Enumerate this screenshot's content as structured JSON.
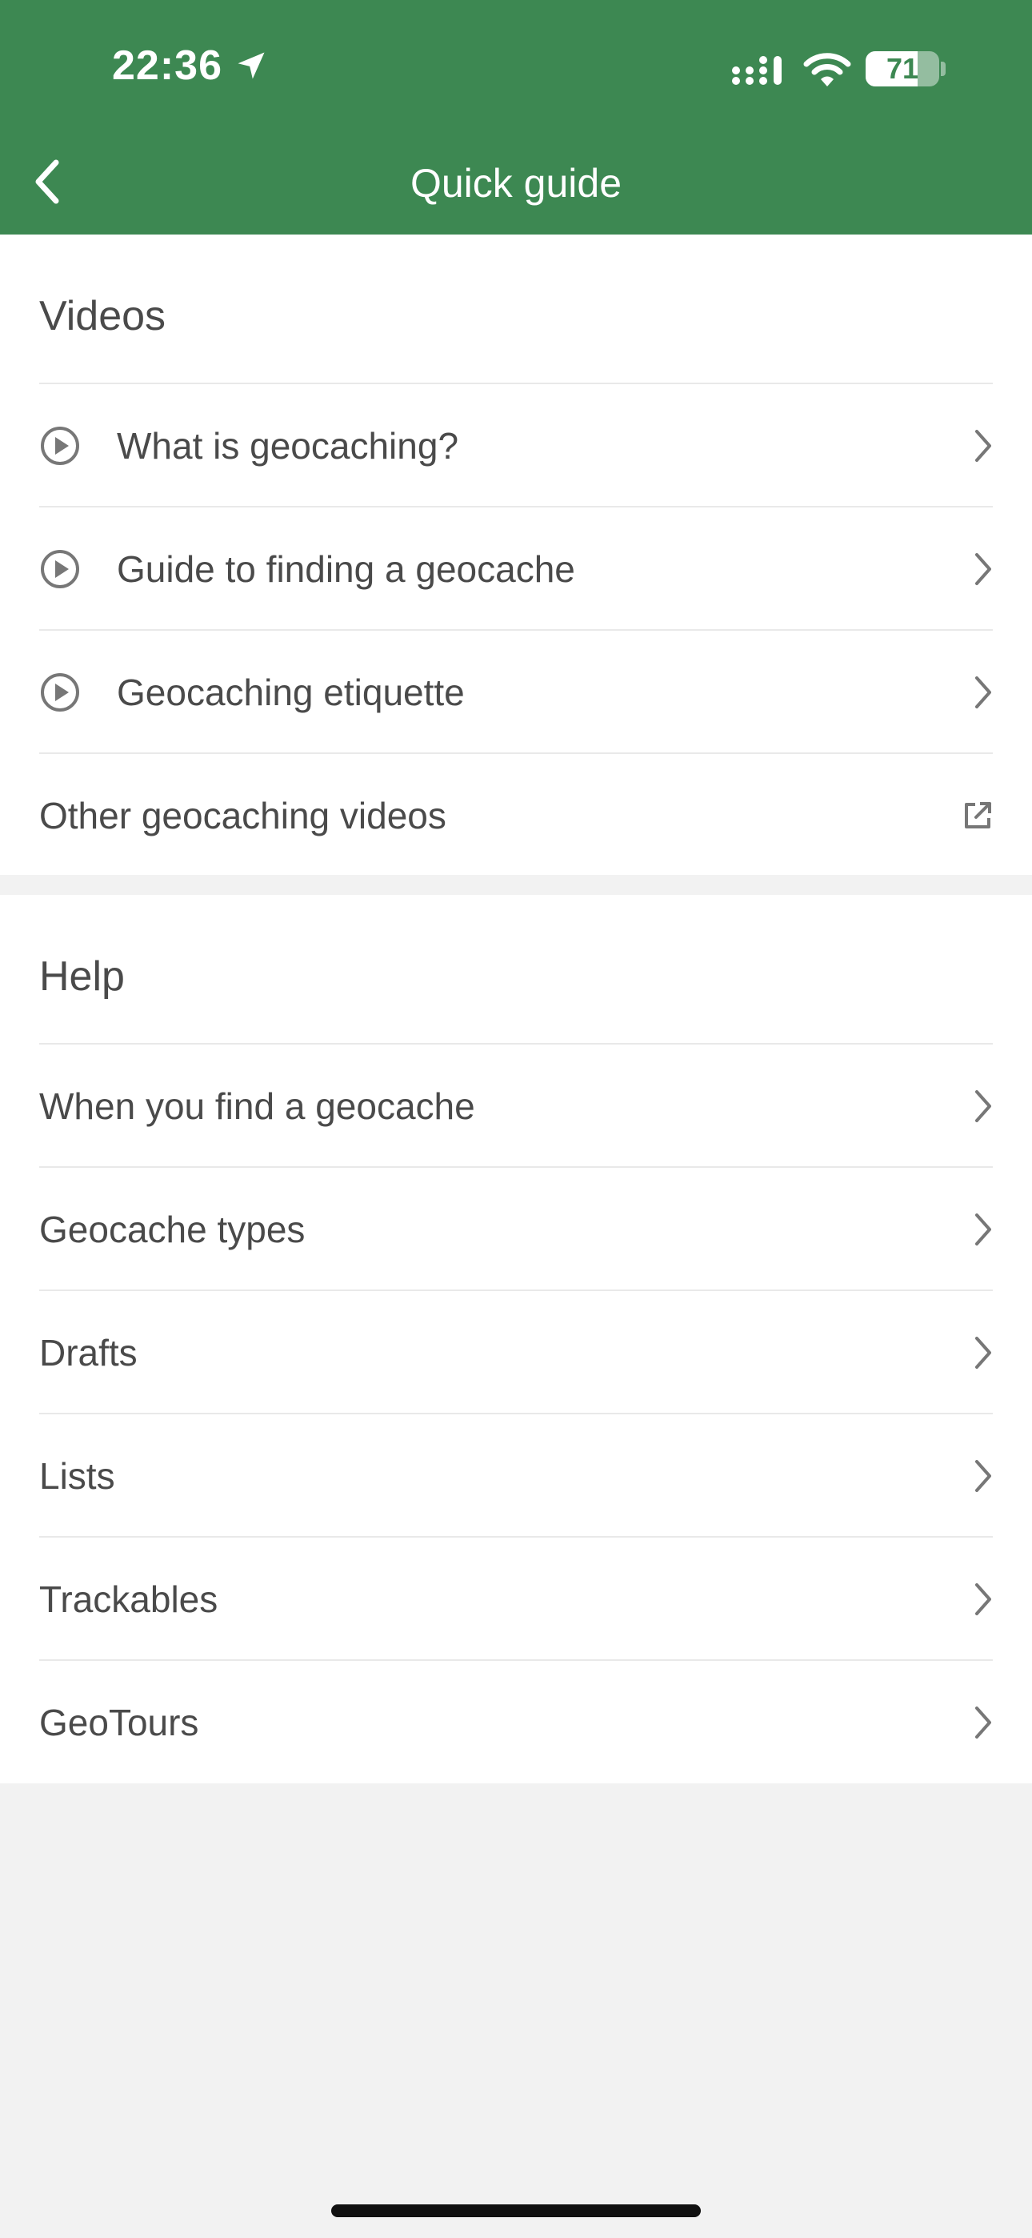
{
  "status_bar": {
    "time": "22:36",
    "location_icon": "location-arrow-icon",
    "signal_icon": "cellular-signal-icon",
    "wifi_icon": "wifi-icon",
    "battery_level": "71",
    "battery_fraction": 0.71
  },
  "nav": {
    "back_icon": "chevron-left-icon",
    "title": "Quick guide"
  },
  "videos": {
    "heading": "Videos",
    "items": [
      {
        "label": "What is geocaching?",
        "icon": "play-circle-icon",
        "trailing_icon": "chevron-right-icon"
      },
      {
        "label": "Guide to finding a geocache",
        "icon": "play-circle-icon",
        "trailing_icon": "chevron-right-icon"
      },
      {
        "label": "Geocaching etiquette",
        "icon": "play-circle-icon",
        "trailing_icon": "chevron-right-icon"
      },
      {
        "label": "Other geocaching videos",
        "trailing_icon": "external-link-icon"
      }
    ]
  },
  "help": {
    "heading": "Help",
    "items": [
      {
        "label": "When you find a geocache",
        "trailing_icon": "chevron-right-icon"
      },
      {
        "label": "Geocache types",
        "trailing_icon": "chevron-right-icon"
      },
      {
        "label": "Drafts",
        "trailing_icon": "chevron-right-icon"
      },
      {
        "label": "Lists",
        "trailing_icon": "chevron-right-icon"
      },
      {
        "label": "Trackables",
        "trailing_icon": "chevron-right-icon"
      },
      {
        "label": "GeoTours",
        "trailing_icon": "chevron-right-icon"
      }
    ]
  },
  "colors": {
    "header_green": "#3d8852",
    "text": "#4a4a4a",
    "icon_gray": "#777777",
    "background": "#f2f2f2",
    "divider": "#e9e9e9"
  }
}
